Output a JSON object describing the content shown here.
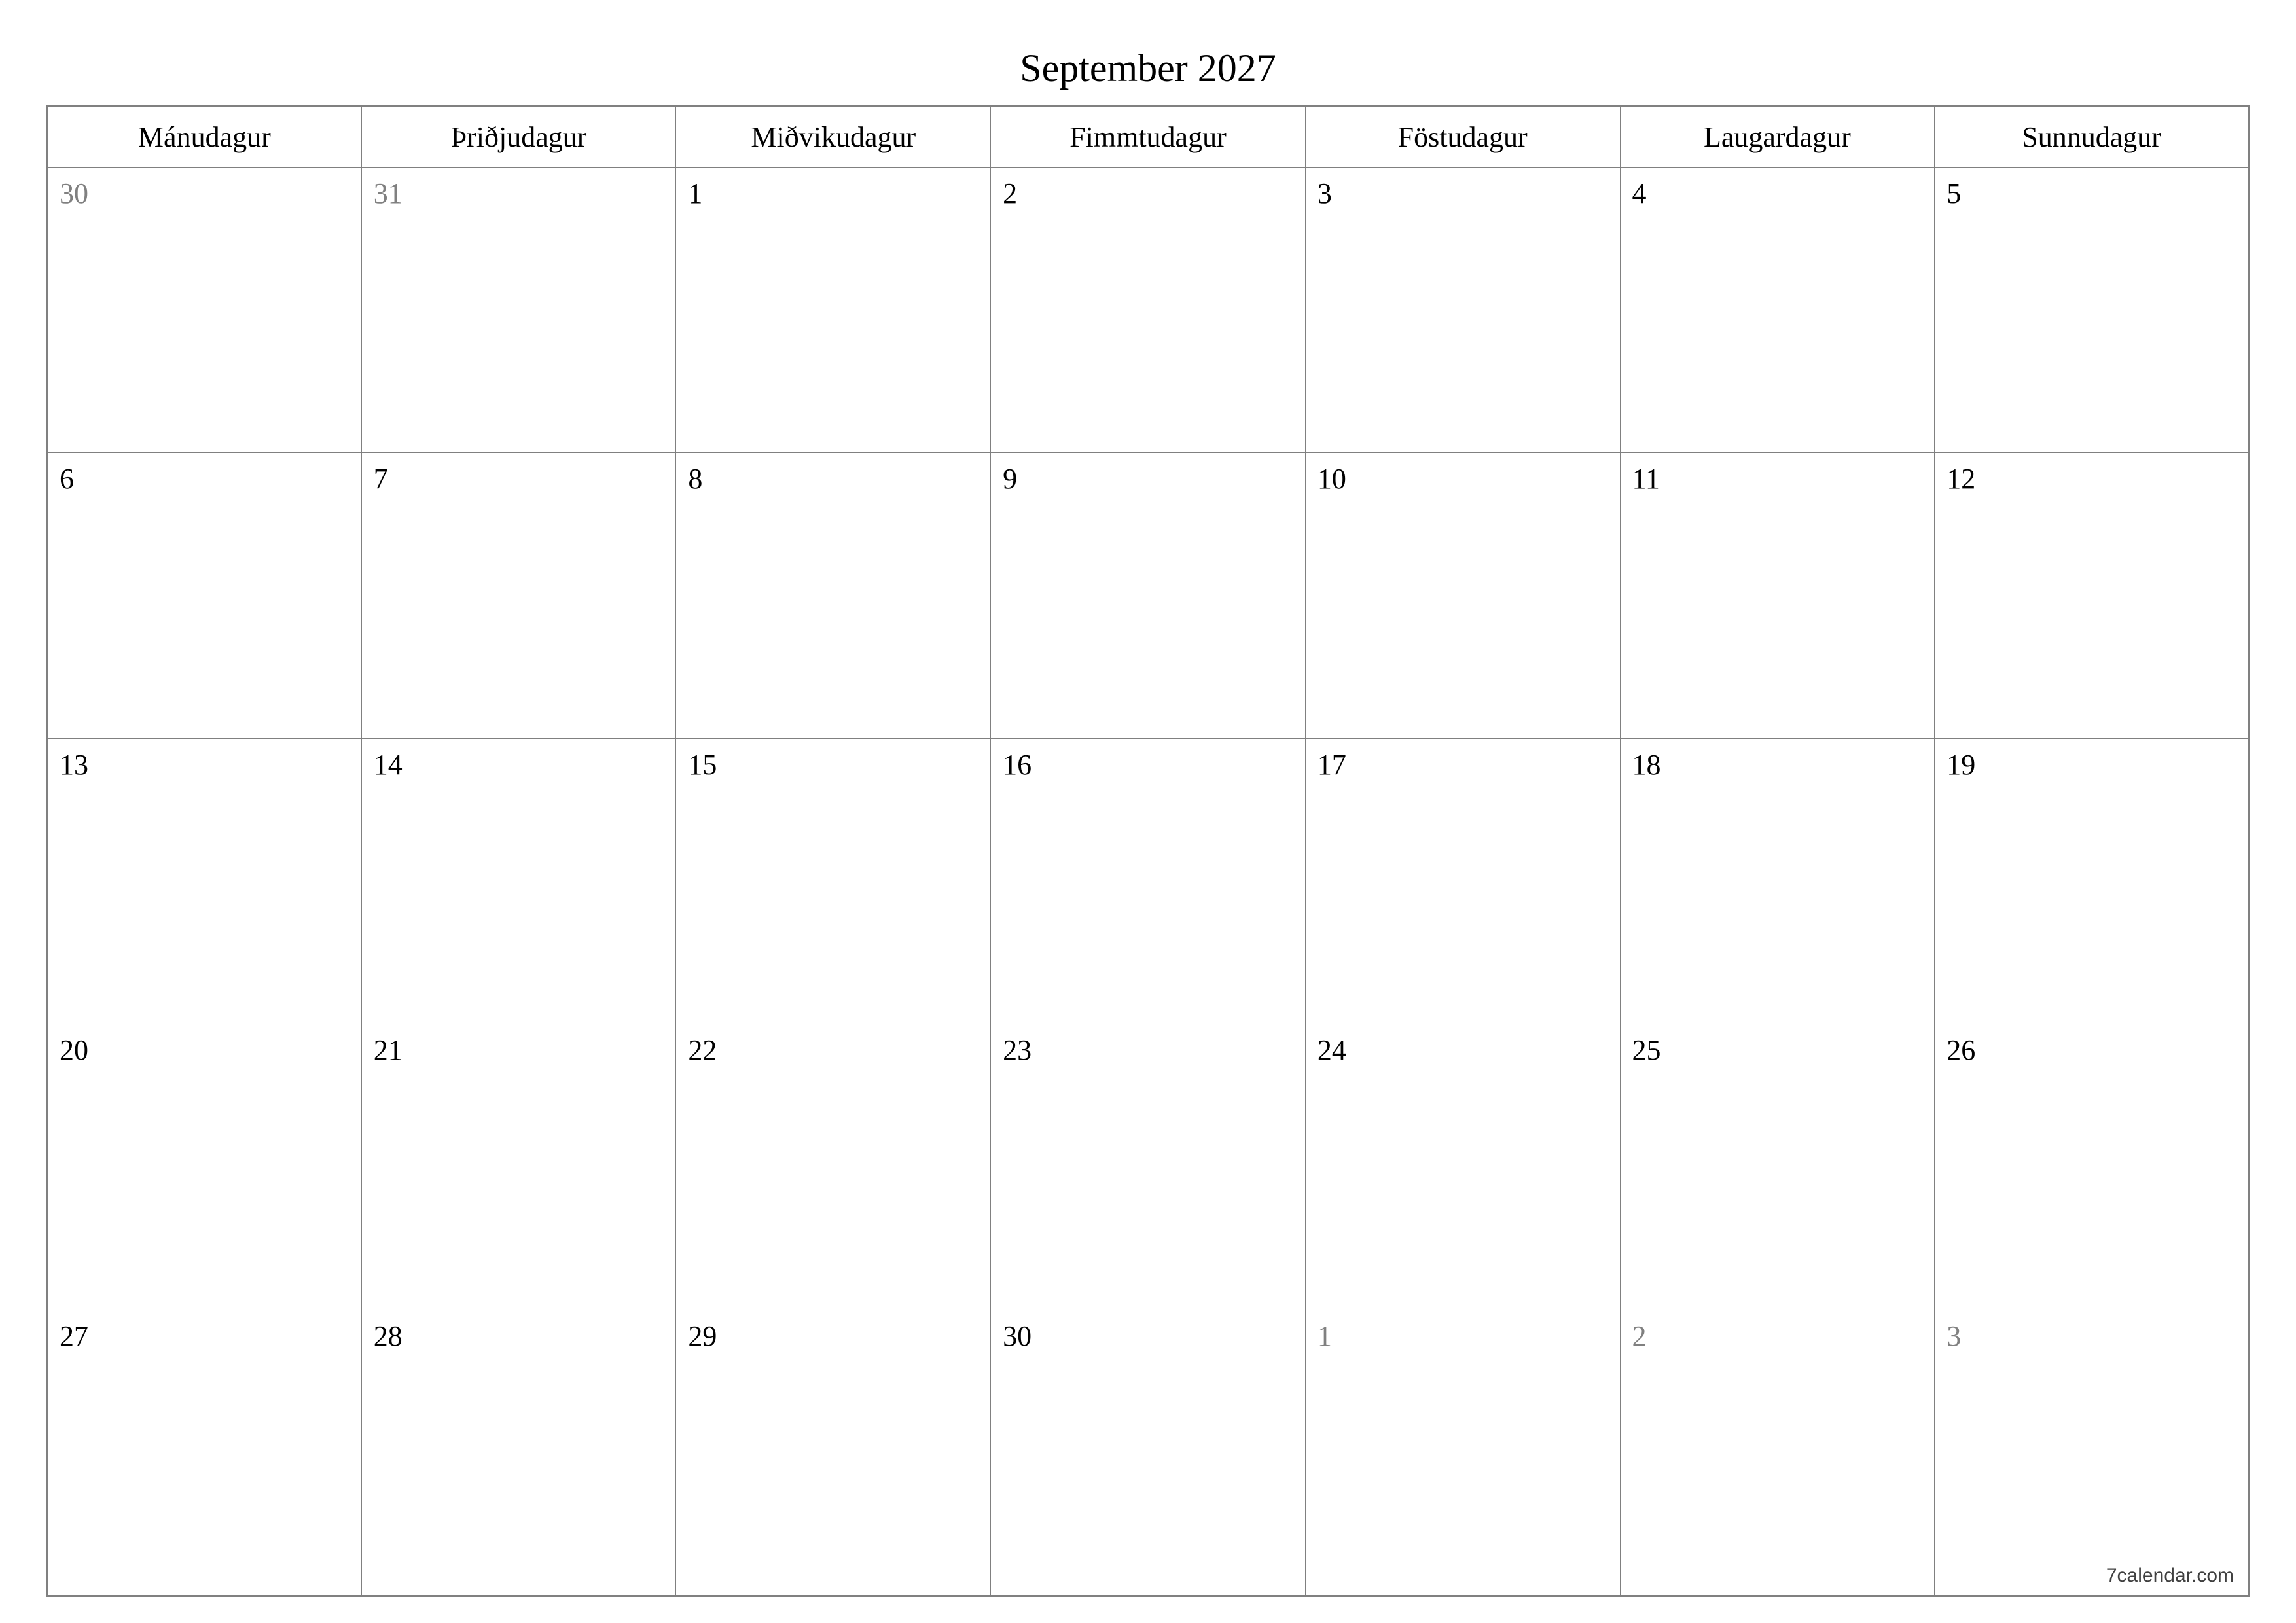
{
  "title": "September 2027",
  "footer": "7calendar.com",
  "weekdays": [
    "Mánudagur",
    "Þriðjudagur",
    "Miðvikudagur",
    "Fimmtudagur",
    "Föstudagur",
    "Laugardagur",
    "Sunnudagur"
  ],
  "weeks": [
    [
      {
        "day": "30",
        "other": true
      },
      {
        "day": "31",
        "other": true
      },
      {
        "day": "1",
        "other": false
      },
      {
        "day": "2",
        "other": false
      },
      {
        "day": "3",
        "other": false
      },
      {
        "day": "4",
        "other": false
      },
      {
        "day": "5",
        "other": false
      }
    ],
    [
      {
        "day": "6",
        "other": false
      },
      {
        "day": "7",
        "other": false
      },
      {
        "day": "8",
        "other": false
      },
      {
        "day": "9",
        "other": false
      },
      {
        "day": "10",
        "other": false
      },
      {
        "day": "11",
        "other": false
      },
      {
        "day": "12",
        "other": false
      }
    ],
    [
      {
        "day": "13",
        "other": false
      },
      {
        "day": "14",
        "other": false
      },
      {
        "day": "15",
        "other": false
      },
      {
        "day": "16",
        "other": false
      },
      {
        "day": "17",
        "other": false
      },
      {
        "day": "18",
        "other": false
      },
      {
        "day": "19",
        "other": false
      }
    ],
    [
      {
        "day": "20",
        "other": false
      },
      {
        "day": "21",
        "other": false
      },
      {
        "day": "22",
        "other": false
      },
      {
        "day": "23",
        "other": false
      },
      {
        "day": "24",
        "other": false
      },
      {
        "day": "25",
        "other": false
      },
      {
        "day": "26",
        "other": false
      }
    ],
    [
      {
        "day": "27",
        "other": false
      },
      {
        "day": "28",
        "other": false
      },
      {
        "day": "29",
        "other": false
      },
      {
        "day": "30",
        "other": false
      },
      {
        "day": "1",
        "other": true
      },
      {
        "day": "2",
        "other": true
      },
      {
        "day": "3",
        "other": true
      }
    ]
  ]
}
